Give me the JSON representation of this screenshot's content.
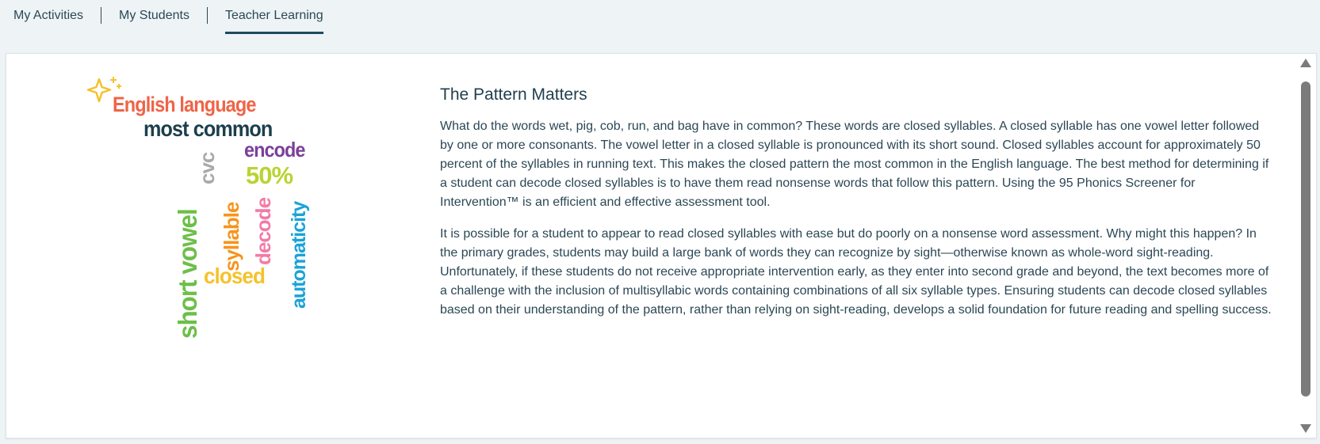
{
  "tabs": [
    {
      "label": "My Activities",
      "active": false
    },
    {
      "label": "My Students",
      "active": false
    },
    {
      "label": "Teacher Learning",
      "active": true
    }
  ],
  "word_cloud": {
    "words": [
      {
        "text": "English language",
        "color": "#ef6448"
      },
      {
        "text": "most common",
        "color": "#1d3f4c"
      },
      {
        "text": "encode",
        "color": "#7b3f98"
      },
      {
        "text": "cvc",
        "color": "#a7a9ab"
      },
      {
        "text": "50%",
        "color": "#b8d432"
      },
      {
        "text": "short vowel",
        "color": "#6cbf48"
      },
      {
        "text": "syllable",
        "color": "#f7941d"
      },
      {
        "text": "closed",
        "color": "#f5c22c"
      },
      {
        "text": "decode",
        "color": "#f37ba6"
      },
      {
        "text": "automaticity",
        "color": "#1aa3d8"
      }
    ],
    "sparkle_color": "#f5c22c"
  },
  "article": {
    "title": "The Pattern Matters",
    "paragraphs": [
      "What do the words wet, pig, cob, run, and bag have in common? These words are closed syllables. A closed syllable has one vowel letter followed by one or more consonants. The vowel letter in a closed syllable is pronounced with its short sound. Closed syllables account for approximately 50 percent of the syllables in running text. This makes the closed pattern the most common in the English language. The best method for determining if a student can decode closed syllables is to have them read nonsense words that follow this pattern. Using the 95 Phonics Screener for Intervention™ is an efficient and effective assessment tool.",
      "It is possible for a student to appear to read closed syllables with ease but do poorly on a nonsense word assessment. Why might this happen? In the primary grades, students may build a large bank of words they can recognize by sight—otherwise known as whole-word sight-reading. Unfortunately, if these students do not receive appropriate intervention early, as they enter into second grade and beyond, the text becomes more of a challenge with the inclusion of multisyllabic words containing combinations of all six syllable types. Ensuring students can decode closed syllables based on their understanding of the pattern, rather than relying on sight-reading, develops a solid foundation for future reading and spelling success."
    ]
  }
}
